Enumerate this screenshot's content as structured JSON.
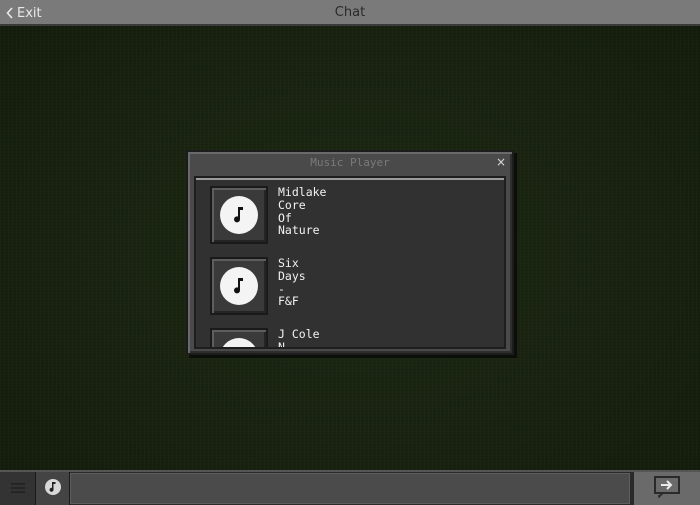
{
  "topbar": {
    "exit_label": "Exit",
    "title": "Chat"
  },
  "dialog": {
    "title": "Music Player",
    "close_glyph": "×",
    "tracks": [
      {
        "label": "Midlake\nCore\nOf\nNature",
        "icon": "music-note-icon"
      },
      {
        "label": "Six\nDays\n-\nF&F",
        "icon": "music-note-icon"
      },
      {
        "label": "J Cole\nN",
        "icon": "music-note-icon"
      }
    ]
  },
  "bottombar": {
    "chat_placeholder": "",
    "menu_icon": "menu-icon",
    "music_icon": "music-note-icon",
    "send_icon": "send-arrow-icon"
  },
  "colors": {
    "background": "#1a2411",
    "topbar": "#7a7a7a",
    "dialog": "#4a4a4a",
    "panel": "#313131"
  }
}
